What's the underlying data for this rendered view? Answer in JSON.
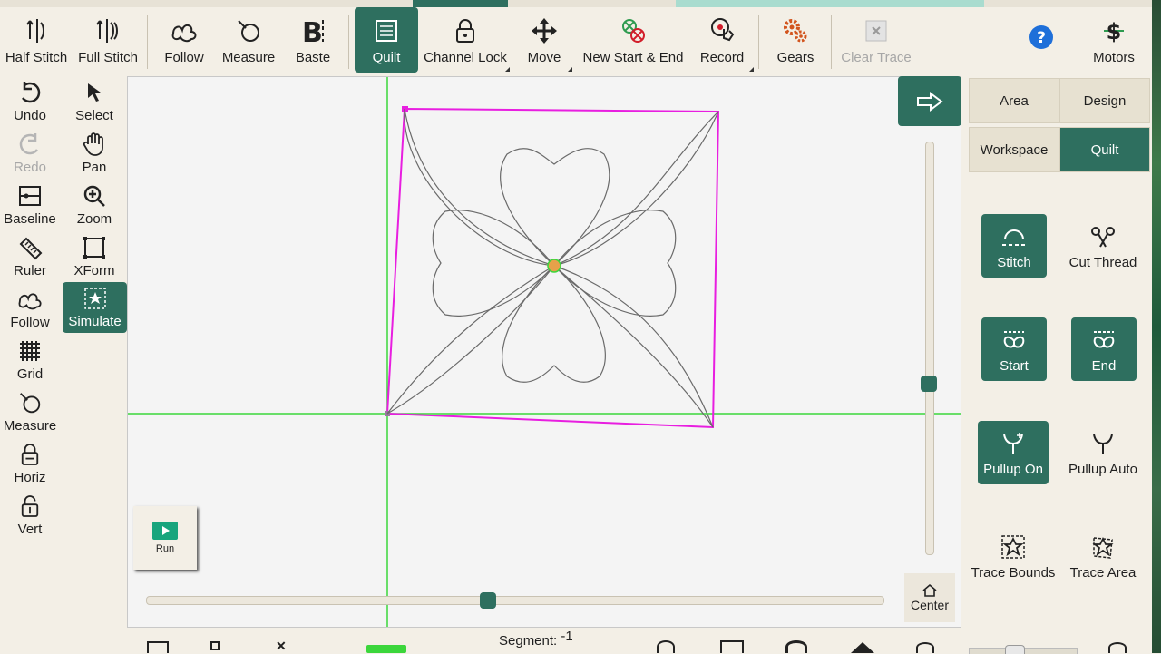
{
  "toolbar": {
    "half_stitch": "Half Stitch",
    "full_stitch": "Full Stitch",
    "follow": "Follow",
    "measure": "Measure",
    "baste": "Baste",
    "quilt": "Quilt",
    "channel_lock": "Channel Lock",
    "move": "Move",
    "new_start_end": "New Start & End",
    "record": "Record",
    "gears": "Gears",
    "clear_trace": "Clear Trace",
    "motors": "Motors"
  },
  "sidebar": {
    "undo": "Undo",
    "select": "Select",
    "redo": "Redo",
    "pan": "Pan",
    "baseline": "Baseline",
    "zoom": "Zoom",
    "ruler": "Ruler",
    "xform": "XForm",
    "follow": "Follow",
    "simulate": "Simulate",
    "grid": "Grid",
    "measure": "Measure",
    "horiz": "Horiz",
    "vert": "Vert"
  },
  "canvas": {
    "run_label": "Run",
    "center_label": "Center"
  },
  "panel": {
    "tabs": {
      "area": "Area",
      "design": "Design",
      "workspace": "Workspace",
      "quilt": "Quilt"
    },
    "stitch": "Stitch",
    "cut_thread": "Cut Thread",
    "start": "Start",
    "end": "End",
    "pullup_on": "Pullup On",
    "pullup_auto": "Pullup Auto",
    "trace_bounds": "Trace Bounds",
    "trace_area": "Trace Area"
  },
  "status": {
    "segment_label": "Segment:",
    "segment_value": "-1"
  },
  "colors": {
    "accent": "#2e6f5f",
    "panel_bg": "#f3efe6",
    "boundary": "#e81ee0",
    "guide": "#3bd63b"
  }
}
